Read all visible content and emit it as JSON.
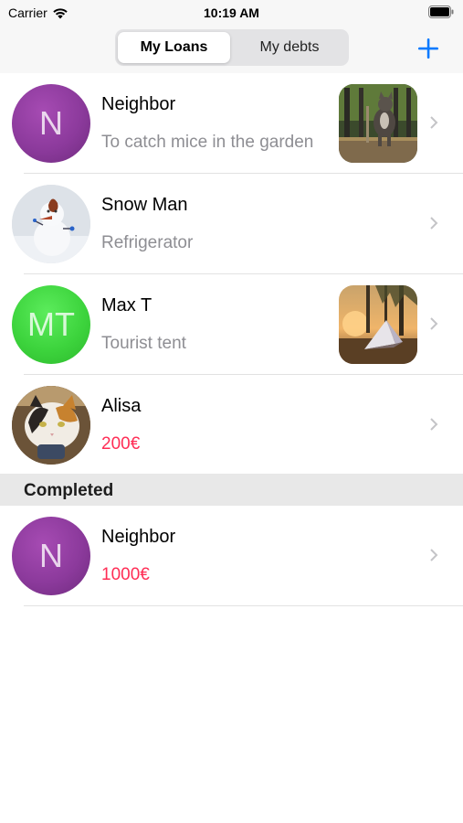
{
  "status_bar": {
    "carrier": "Carrier",
    "time": "10:19 AM"
  },
  "nav": {
    "segments": [
      "My Loans",
      "My debts"
    ],
    "selected_segment": "My Loans",
    "add_icon": "plus-icon",
    "accent_color": "#0a7aff"
  },
  "loans": [
    {
      "name": "Neighbor",
      "initials": "N",
      "detail": "To catch mice in the garden",
      "has_photo": true
    },
    {
      "name": "Snow Man",
      "detail": "Refrigerator",
      "has_photo": false
    },
    {
      "name": "Max T",
      "initials": "MT",
      "detail": "Tourist tent",
      "has_photo": true
    },
    {
      "name": "Alisa",
      "detail": "200€",
      "has_photo": false
    }
  ],
  "completed": {
    "title": "Completed",
    "items": [
      {
        "name": "Neighbor",
        "initials": "N",
        "detail": "1000€"
      }
    ]
  },
  "colors": {
    "amount": "#ff2d55",
    "subtitle": "#8e8e93",
    "avatar_purple": "#8c3a9c",
    "avatar_green": "#3dd43d"
  }
}
